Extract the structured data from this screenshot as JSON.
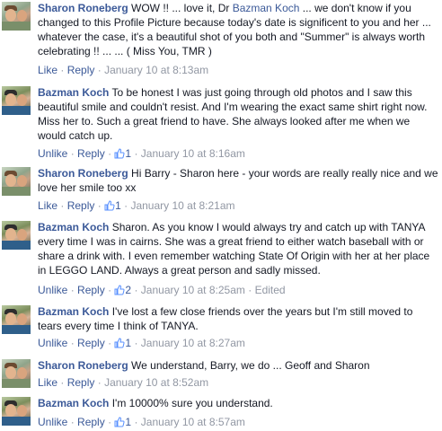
{
  "comments": [
    {
      "author": "Sharon Roneberg",
      "text_before": " WOW !! ... love it, Dr ",
      "mention": "Bazman Koch",
      "text_after": " ... we don't know if you changed to this Profile Picture because today's date is significent to you and her ... whatever the case, it's a beautiful shot of you both and \"Summer\" is always worth celebrating !! ... ... ( Miss You, TMR )",
      "actions": [
        "Like",
        "Reply"
      ],
      "like_count": "",
      "time": "January 10 at 8:13am",
      "edited": ""
    },
    {
      "author": "Bazman Koch",
      "text": " To be honest I was just going through old photos and I saw this beautiful smile and couldn't resist. And I'm wearing the exact same shirt right now. Miss her to. Such a great friend to have. She always looked after me when we would catch up.",
      "actions": [
        "Unlike",
        "Reply"
      ],
      "like_count": "1",
      "time": "January 10 at 8:16am",
      "edited": ""
    },
    {
      "author": "Sharon Roneberg",
      "text": " Hi Barry - Sharon here - your words are really really nice and we love her smile too xx",
      "actions": [
        "Like",
        "Reply"
      ],
      "like_count": "1",
      "time": "January 10 at 8:21am",
      "edited": ""
    },
    {
      "author": "Bazman Koch",
      "text": " Sharon. As you know I would always try and catch up with TANYA every time I was in cairns. She was a great friend to either watch baseball with or share a drink with. I even remember watching State Of Origin with her at her place in LEGGO LAND. Always a great person and sadly missed.",
      "actions": [
        "Unlike",
        "Reply"
      ],
      "like_count": "2",
      "time": "January 10 at 8:25am",
      "edited": "Edited"
    },
    {
      "author": "Bazman Koch",
      "text": " I've lost a few close friends over the years but I'm still moved to tears every time I think of TANYA.",
      "actions": [
        "Unlike",
        "Reply"
      ],
      "like_count": "1",
      "time": "January 10 at 8:27am",
      "edited": ""
    },
    {
      "author": "Sharon Roneberg",
      "text": " We understand, Barry, we do ... Geoff and Sharon",
      "actions": [
        "Like",
        "Reply"
      ],
      "like_count": "",
      "time": "January 10 at 8:52am",
      "edited": ""
    },
    {
      "author": "Bazman Koch",
      "text": " I'm 10000% sure you understand.",
      "actions": [
        "Unlike",
        "Reply"
      ],
      "like_count": "1",
      "time": "January 10 at 8:57am",
      "edited": ""
    }
  ],
  "separator": "·",
  "colors": {
    "link": "#3b5998",
    "meta": "#9197a3",
    "text": "#141823"
  }
}
